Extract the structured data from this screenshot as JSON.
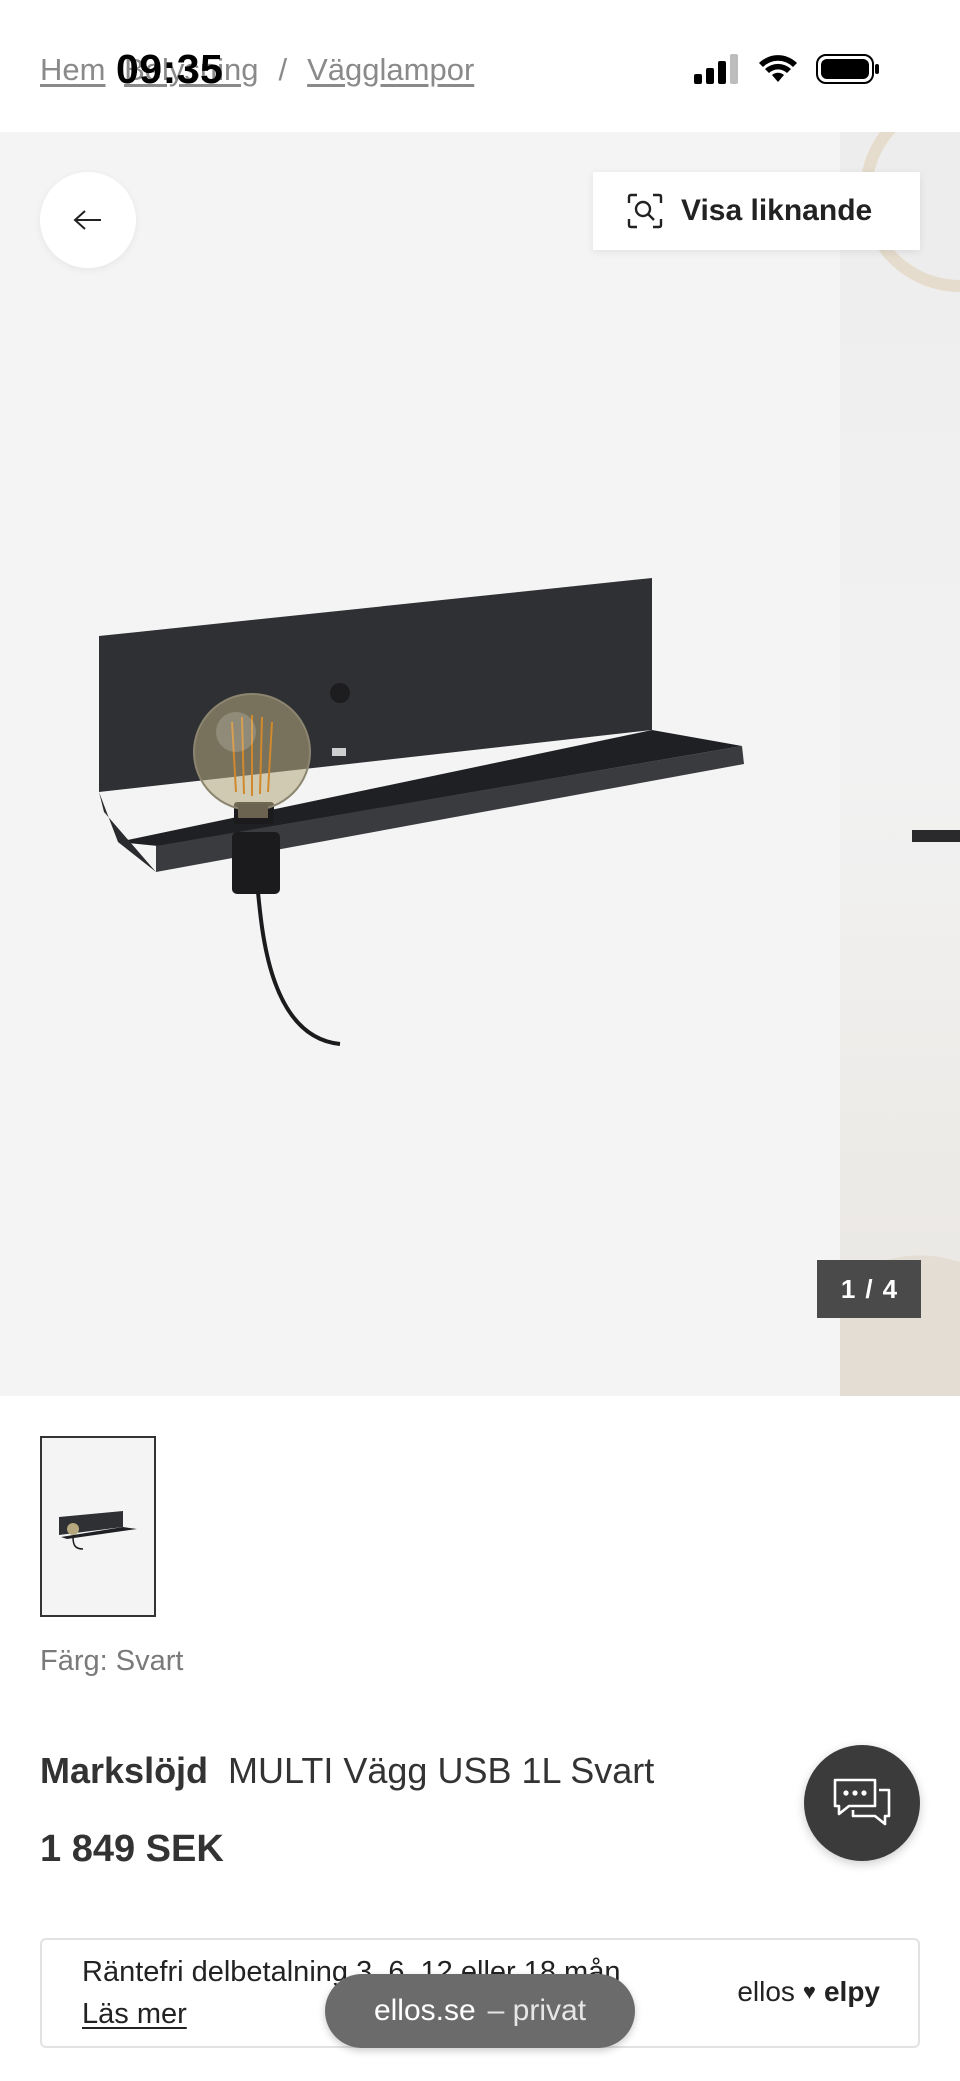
{
  "status_bar": {
    "time": "09:35"
  },
  "breadcrumb": {
    "items": [
      "Hem",
      "Belysning",
      "Vägglampor"
    ],
    "separator": "/"
  },
  "gallery": {
    "similar_label": "Visa liknande",
    "counter_current": "1",
    "counter_sep": "/",
    "counter_total": "4"
  },
  "product": {
    "color_label": "Färg: Svart",
    "brand": "Markslöjd",
    "name": "MULTI Vägg USB 1L Svart",
    "price": "1 849 SEK"
  },
  "payment": {
    "text": "Räntefri delbetalning 3, 6, 12 eller 18 mån",
    "link": "Läs mer",
    "logo_left": "ellos",
    "logo_right": "elpy"
  },
  "site_pill": {
    "domain": "ellos.se",
    "rest": "– privat"
  },
  "icons": {
    "back": "arrow-left-icon",
    "similar": "image-search-icon",
    "chat": "chat-bubbles-icon",
    "signal": "signal-icon",
    "wifi": "wifi-icon",
    "battery": "battery-icon"
  },
  "colors": {
    "counter_bg": "#4a4a4a",
    "chat_bg": "#3b3b3b",
    "pill_bg": "#6b6b6b"
  }
}
